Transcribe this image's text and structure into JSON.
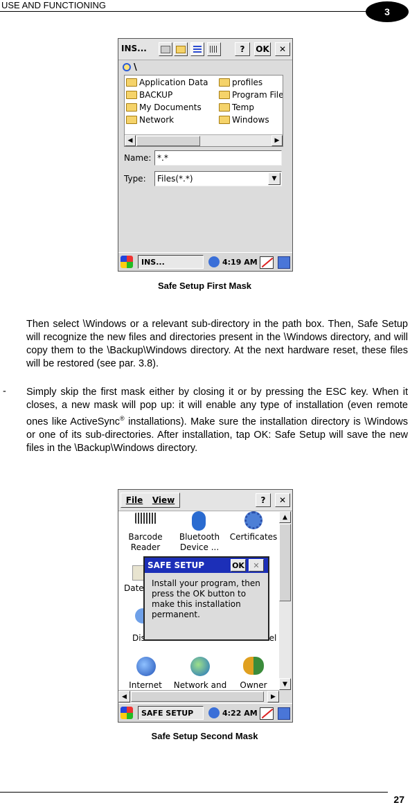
{
  "header": {
    "title": "USE AND FUNCTIONING",
    "chapter": "3"
  },
  "footer": {
    "page_number": "27"
  },
  "figure1": {
    "caption": "Safe Setup First Mask",
    "toolbar_title": "INS...",
    "help_label": "?",
    "ok_label": "OK",
    "close_label": "✕",
    "path": "\\",
    "folders": [
      "Application Data",
      "BACKUP",
      "My Documents",
      "Network",
      "profiles",
      "Program Files",
      "Temp",
      "Windows"
    ],
    "name_label": "Name:",
    "name_value": "*.*",
    "type_label": "Type:",
    "type_value": "Files(*.*)",
    "task_title": "INS...",
    "clock": "4:19 AM"
  },
  "body": {
    "para1": "Then select \\Windows or a relevant sub-directory in the path box. Then, Safe Setup will recognize the new files and directories present in the \\Windows directory, and will copy them to the \\Backup\\Windows directory. At the next hardware reset, these files will be restored (see par. 3.8).",
    "bullet_dash": "-",
    "bullet_pre": "Simply skip the first mask either by closing it or by pressing the ESC key. When it closes, a new mask will pop up: it will enable any type of installation (even remote ones like ActiveSync",
    "bullet_sup": "®",
    "bullet_post": " installations). Make sure the installation directory is \\Windows or one of its sub-directories. After installation, tap OK: Safe Setup will save the new files in the \\Backup\\Windows directory."
  },
  "figure2": {
    "caption": "Safe Setup Second Mask",
    "menu_file": "File",
    "menu_view": "View",
    "help_label": "?",
    "close_label": "✕",
    "icons": [
      {
        "label1": "Barcode",
        "label2": "Reader"
      },
      {
        "label1": "Bluetooth",
        "label2": "Device ..."
      },
      {
        "label1": "Certificates",
        "label2": ""
      },
      {
        "label1": "Date",
        "label2": ""
      },
      {
        "label1": "Dis",
        "label2": ""
      },
      {
        "label1": "nel",
        "label2": ""
      },
      {
        "label1": "Internet",
        "label2": ""
      },
      {
        "label1": "Network and",
        "label2": ""
      },
      {
        "label1": "Owner",
        "label2": ""
      }
    ],
    "dialog_title": "SAFE SETUP",
    "dialog_ok": "OK",
    "dialog_close": "✕",
    "dialog_text": "Install your program, then press the OK button to make this installation permanent.",
    "task_title": "SAFE SETUP",
    "clock": "4:22 AM"
  }
}
